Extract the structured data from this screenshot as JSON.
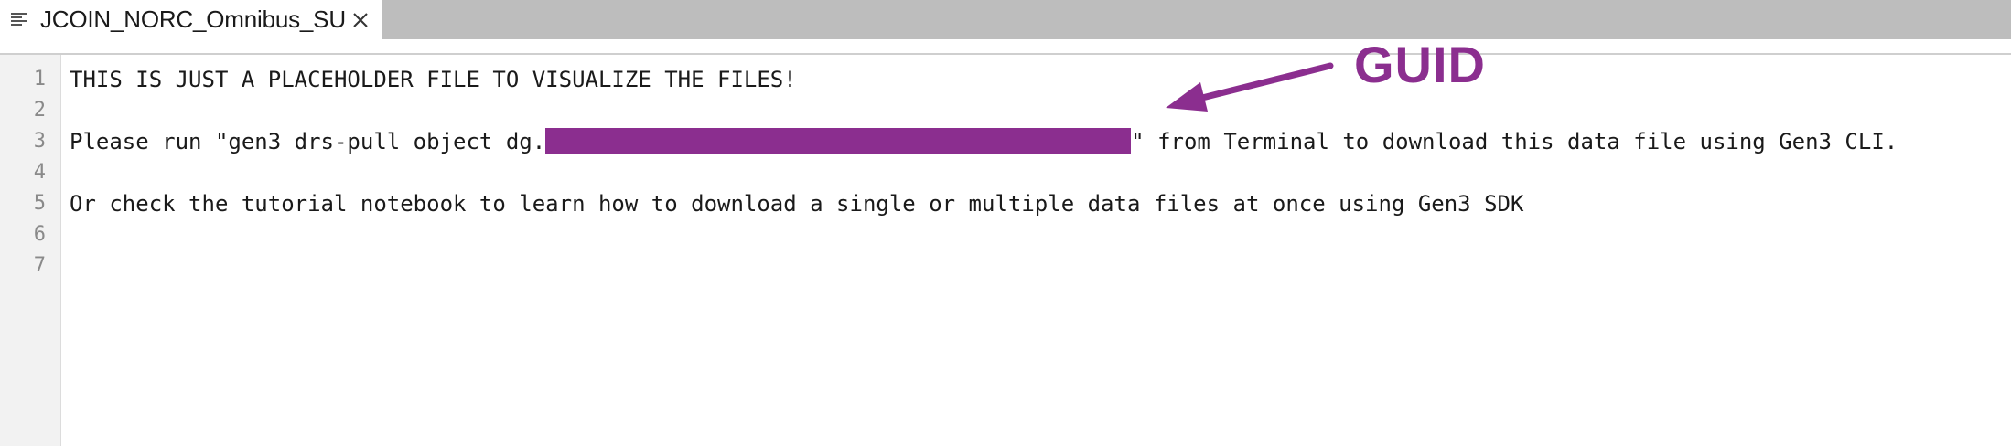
{
  "tab": {
    "title": "JCOIN_NORC_Omnibus_SU",
    "icon": "text-file-icon",
    "close_icon": "close-icon"
  },
  "editor": {
    "lines": [
      {
        "number": "1",
        "text": "THIS IS JUST A PLACEHOLDER FILE TO VISUALIZE THE FILES!"
      },
      {
        "number": "2",
        "text": ""
      },
      {
        "number": "3",
        "prefix": "Please run \"gen3 drs-pull object dg.",
        "suffix": "\" from Terminal to download this data file using Gen3 CLI."
      },
      {
        "number": "4",
        "text": ""
      },
      {
        "number": "5",
        "text": "Or check the tutorial notebook to learn how to download a single or multiple data files at once using Gen3 SDK"
      },
      {
        "number": "6",
        "text": ""
      },
      {
        "number": "7",
        "text": ""
      }
    ]
  },
  "annotation": {
    "label": "GUID",
    "color": "#8b2e8f"
  }
}
